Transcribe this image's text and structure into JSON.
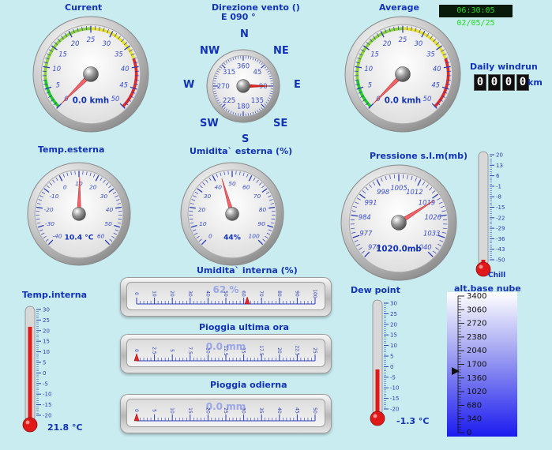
{
  "clock": "06:30:05 02/05/25",
  "current_wind": {
    "title": "Current",
    "reading": "0.0 kmh",
    "ticks": [
      "0",
      "5",
      "10",
      "15",
      "20",
      "25",
      "30",
      "35",
      "40",
      "45",
      "50"
    ],
    "value": 0,
    "min": 0,
    "max": 50
  },
  "wind_direction": {
    "title": "Direzione vento ()",
    "reading": "E  090 °",
    "compass": {
      "n": "N",
      "ne": "NE",
      "e": "E",
      "se": "SE",
      "s": "S",
      "sw": "SW",
      "w": "W",
      "nw": "NW"
    },
    "ticks": [
      "360",
      "45",
      "90",
      "135",
      "180",
      "225",
      "270",
      "315"
    ],
    "value": 90
  },
  "average_wind": {
    "title": "Average",
    "reading": "0.0 kmh",
    "ticks": [
      "0",
      "5",
      "10",
      "15",
      "20",
      "25",
      "30",
      "35",
      "40",
      "45",
      "50"
    ],
    "value": 0,
    "min": 0,
    "max": 50
  },
  "daily_windrun": {
    "title": "Daily windrun",
    "digits": [
      "0",
      "0",
      "0",
      "0"
    ],
    "unit": "km"
  },
  "temp_esterna": {
    "title": "Temp.esterna",
    "reading": "10.4 °C",
    "ticks": [
      "-40",
      "-30",
      "-20",
      "-10",
      "0",
      "10",
      "20",
      "30",
      "40",
      "50",
      "60"
    ],
    "value": 10.4,
    "min": -40,
    "max": 60
  },
  "umidita_esterna": {
    "title": "Umidita` esterna (%)",
    "reading": "44%",
    "ticks": [
      "0",
      "10",
      "20",
      "30",
      "40",
      "50",
      "60",
      "70",
      "80",
      "90",
      "100"
    ],
    "value": 44,
    "min": 0,
    "max": 100
  },
  "pressione": {
    "title": "Pressione s.l.m(mb)",
    "reading": "1020.0mb",
    "ticks": [
      "970",
      "977",
      "984",
      "991",
      "998",
      "1005",
      "1012",
      "1019",
      "1026",
      "1033",
      "1040"
    ],
    "value": 1020,
    "min": 970,
    "max": 1040
  },
  "chill": {
    "label": "Chill",
    "ticks": [
      "20",
      "13",
      "6",
      "-1",
      "-8",
      "-15",
      "-22",
      "-29",
      "-36",
      "-43",
      "-50"
    ],
    "value": -50,
    "min": -50,
    "max": 20
  },
  "umidita_interna": {
    "title": "Umidita` interna (%)",
    "reading": "62 %",
    "ticks": [
      "0",
      "10",
      "20",
      "30",
      "40",
      "50",
      "60",
      "70",
      "80",
      "90",
      "100"
    ],
    "value": 62,
    "min": 0,
    "max": 100
  },
  "pioggia_ora": {
    "title": "Pioggia ultima ora",
    "reading": "0.0 mm",
    "ticks": [
      "0",
      "2.5",
      "5",
      "7.5",
      "10",
      "12.5",
      "15",
      "17.5",
      "20",
      "22.5",
      "25"
    ],
    "value": 0,
    "min": 0,
    "max": 25
  },
  "pioggia_odierna": {
    "title": "Pioggia odierna",
    "reading": "0.0 mm",
    "ticks": [
      "0",
      "5",
      "10",
      "15",
      "20",
      "25",
      "30",
      "35",
      "40",
      "45",
      "50"
    ],
    "value": 0,
    "min": 0,
    "max": 50
  },
  "temp_interna": {
    "title": "Temp.interna",
    "reading": "21.8 °C",
    "ticks": [
      "30",
      "25",
      "20",
      "15",
      "10",
      "5",
      "0",
      "-5",
      "-10",
      "-15",
      "-20"
    ],
    "value": 21.8,
    "min": -20,
    "max": 30
  },
  "dew_point": {
    "title": "Dew point",
    "reading": "-1.3 °C",
    "ticks": [
      "30",
      "25",
      "20",
      "15",
      "10",
      "5",
      "0",
      "-5",
      "-10",
      "-15",
      "-20"
    ],
    "value": -1.3,
    "min": -20,
    "max": 30
  },
  "cloud_base": {
    "title": "alt.base nube",
    "ticks": [
      "3400",
      "3060",
      "2720",
      "2380",
      "2040",
      "1700",
      "1360",
      "1020",
      "680",
      "340",
      "0"
    ],
    "value": 1530,
    "min": 0,
    "max": 3400
  }
}
